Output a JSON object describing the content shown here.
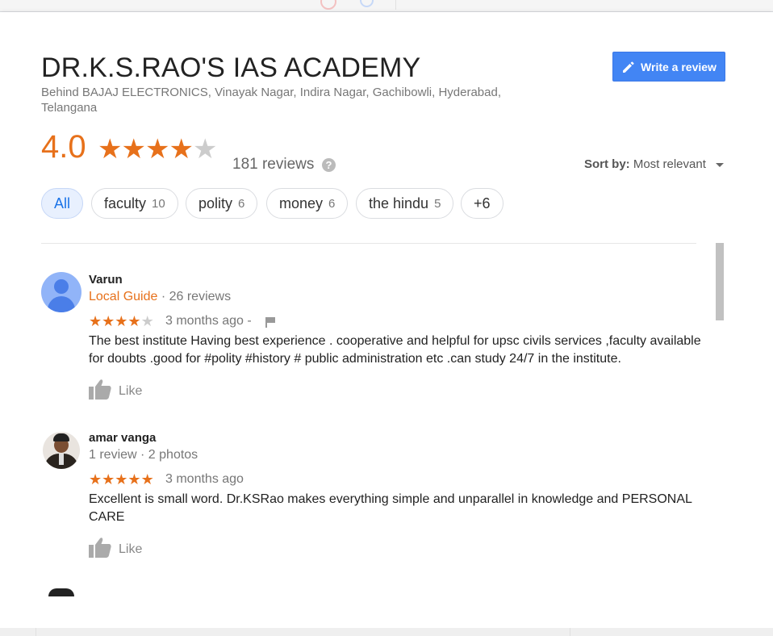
{
  "place": {
    "title": "DR.K.S.RAO'S IAS ACADEMY",
    "address": "Behind BAJAJ ELECTRONICS, Vinayak Nagar, Indira Nagar, Gachibowli, Hyderabad, Telangana",
    "rating": "4.0",
    "rating_stars": 4,
    "review_count": "181 reviews",
    "write_review_label": "Write a review"
  },
  "sort": {
    "label": "Sort by:",
    "value": "Most relevant"
  },
  "filters": [
    {
      "label": "All",
      "count": "",
      "active": true
    },
    {
      "label": "faculty",
      "count": "10"
    },
    {
      "label": "polity",
      "count": "6"
    },
    {
      "label": "money",
      "count": "6"
    },
    {
      "label": "the hindu",
      "count": "5"
    },
    {
      "label": "+6",
      "count": ""
    }
  ],
  "reviews": [
    {
      "name": "Varun",
      "guide": "Local Guide",
      "meta": " · 26 reviews",
      "stars": 4,
      "time": "3 months ago",
      "time_suffix": " -",
      "text": "The best institute Having best experience . cooperative and helpful for upsc civils services ,faculty available for doubts .good for #polity #history # public administration etc .can study 24/7 in the institute.",
      "like_label": "Like"
    },
    {
      "name": "amar vanga",
      "meta": "1 review · 2 photos",
      "stars": 5,
      "time": "3 months ago",
      "text": "Excellent is small word. Dr.KSRao makes everything simple and unparallel in knowledge and PERSONAL CARE",
      "like_label": "Like"
    }
  ],
  "icons": {
    "help": "?",
    "accent": "#e7711b",
    "button_blue": "#4285f4"
  }
}
